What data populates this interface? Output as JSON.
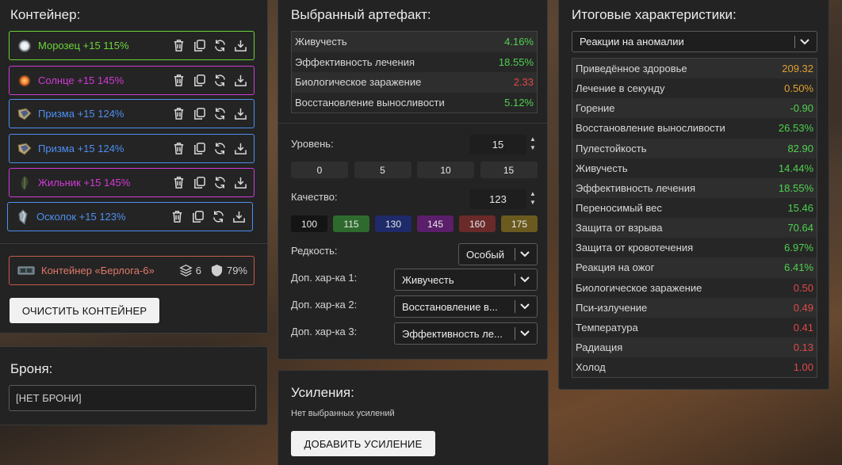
{
  "container_panel": {
    "title": "Контейнер:",
    "artifacts": [
      {
        "name": "Морозец +15 115%",
        "color": "#6cd43a",
        "icon": "frost-orb-icon"
      },
      {
        "name": "Солнце +15 145%",
        "color": "#d13ad6",
        "icon": "sun-orb-icon"
      },
      {
        "name": "Призма +15 124%",
        "color": "#4e8ff0",
        "icon": "prism-icon"
      },
      {
        "name": "Призма +15 124%",
        "color": "#4e8ff0",
        "icon": "prism-icon"
      },
      {
        "name": "Жильник +15 145%",
        "color": "#d13ad6",
        "icon": "vein-icon"
      },
      {
        "name": "Осколок +15 123%",
        "color": "#4e8ff0",
        "icon": "shard-icon"
      }
    ],
    "container": {
      "name": "Контейнер «Берлога-6»",
      "slots": "6",
      "protection": "79%",
      "color": "#e07a6a"
    },
    "clear_button": "ОЧИСТИТЬ КОНТЕЙНЕР"
  },
  "armor_panel": {
    "title": "Броня:",
    "value": "[НЕТ БРОНИ]"
  },
  "selected_panel": {
    "title": "Выбранный артефакт:",
    "stats": [
      {
        "label": "Живучесть",
        "value": "4.16%",
        "color": "#4fd14f"
      },
      {
        "label": "Эффективность лечения",
        "value": "18.55%",
        "color": "#4fd14f"
      },
      {
        "label": "Биологическое заражение",
        "value": "2.33",
        "color": "#e04848"
      },
      {
        "label": "Восстановление выносливости",
        "value": "5.12%",
        "color": "#4fd14f"
      }
    ],
    "level_label": "Уровень:",
    "level_value": "15",
    "level_presets": [
      "0",
      "5",
      "10",
      "15"
    ],
    "quality_label": "Качество:",
    "quality_value": "123",
    "quality_presets": [
      {
        "label": "100",
        "color": "#141414"
      },
      {
        "label": "115",
        "color": "#2e6a2e"
      },
      {
        "label": "130",
        "color": "#1e2a6a"
      },
      {
        "label": "145",
        "color": "#5a1e6a"
      },
      {
        "label": "160",
        "color": "#6a2a2a"
      },
      {
        "label": "175",
        "color": "#6a5a1e"
      }
    ],
    "rarity_label": "Редкость:",
    "rarity_value": "Особый",
    "extra_stats": [
      {
        "label": "Доп. хар-ка 1:",
        "value": "Живучесть"
      },
      {
        "label": "Доп. хар-ка 2:",
        "value": "Восстановление в..."
      },
      {
        "label": "Доп. хар-ка 3:",
        "value": "Эффективность ле..."
      }
    ]
  },
  "boosts_panel": {
    "title": "Усиления:",
    "empty_text": "Нет выбранных усилений",
    "add_button": "ДОБАВИТЬ УСИЛЕНИЕ"
  },
  "totals_panel": {
    "title": "Итоговые характеристики:",
    "filter_value": "Реакции на аномалии",
    "rows": [
      {
        "label": "Приведённое здоровье",
        "value": "209.32",
        "color": "#e0a030"
      },
      {
        "label": "Лечение в секунду",
        "value": "0.50%",
        "color": "#e0a030"
      },
      {
        "label": "Горение",
        "value": "-0.90",
        "color": "#4fd14f"
      },
      {
        "label": "Восстановление выносливости",
        "value": "26.53%",
        "color": "#4fd14f"
      },
      {
        "label": "Пулестойкость",
        "value": "82.90",
        "color": "#4fd14f"
      },
      {
        "label": "Живучесть",
        "value": "14.44%",
        "color": "#4fd14f"
      },
      {
        "label": "Эффективность лечения",
        "value": "18.55%",
        "color": "#4fd14f"
      },
      {
        "label": "Переносимый вес",
        "value": "15.46",
        "color": "#4fd14f"
      },
      {
        "label": "Защита от взрыва",
        "value": "70.64",
        "color": "#4fd14f"
      },
      {
        "label": "Защита от кровотечения",
        "value": "6.97%",
        "color": "#4fd14f"
      },
      {
        "label": "Реакция на ожог",
        "value": "6.41%",
        "color": "#4fd14f"
      },
      {
        "label": "Биологическое заражение",
        "value": "0.50",
        "color": "#e04848"
      },
      {
        "label": "Пси-излучение",
        "value": "0.49",
        "color": "#e04848"
      },
      {
        "label": "Температура",
        "value": "0.41",
        "color": "#e04848"
      },
      {
        "label": "Радиация",
        "value": "0.13",
        "color": "#e04848"
      },
      {
        "label": "Холод",
        "value": "1.00",
        "color": "#e04848"
      }
    ]
  }
}
